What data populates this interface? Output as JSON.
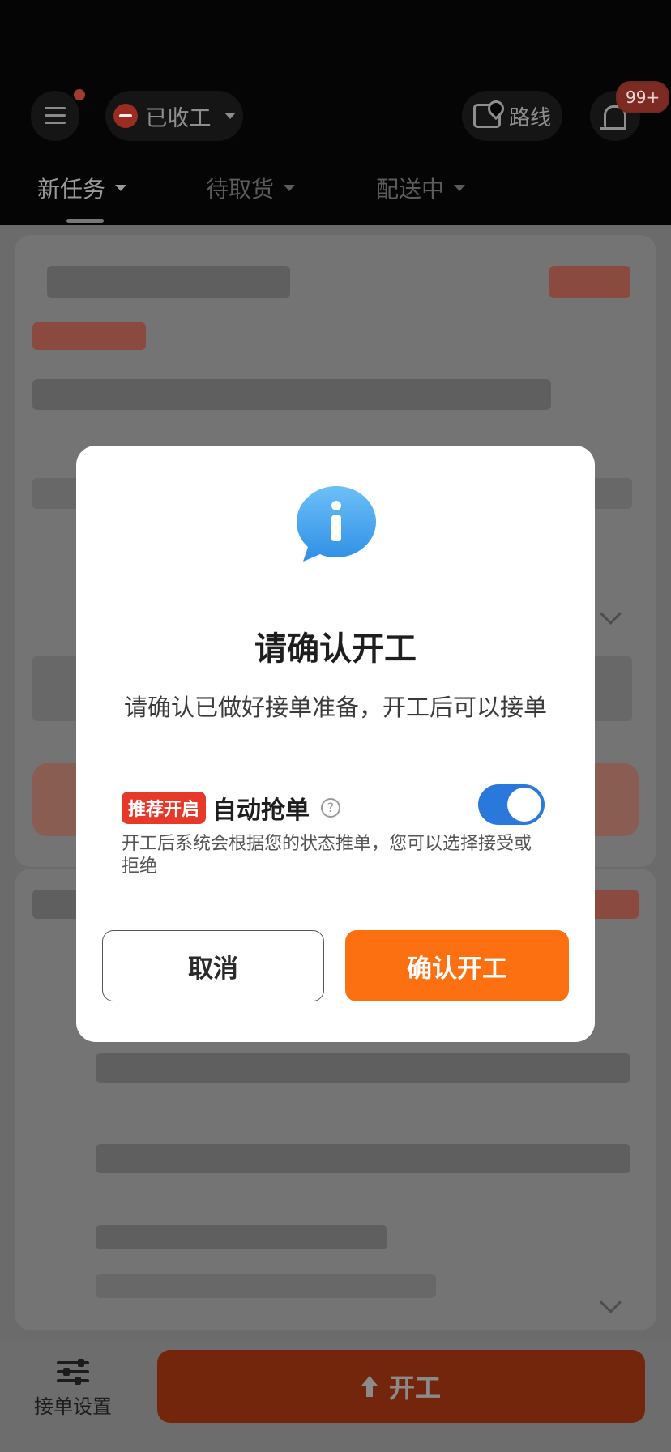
{
  "header": {
    "status_label": "已收工",
    "route_label": "路线",
    "notification_badge": "99+"
  },
  "tabs": [
    {
      "label": "新任务",
      "active": true
    },
    {
      "label": "待取货",
      "active": false
    },
    {
      "label": "配送中",
      "active": false
    }
  ],
  "bottom_bar": {
    "settings_label": "接单设置",
    "start_label": "开工"
  },
  "dialog": {
    "title": "请确认开工",
    "message": "请确认已做好接单准备，开工后可以接单",
    "recommend_tag": "推荐开启",
    "auto_grab_label": "自动抢单",
    "auto_grab_enabled": true,
    "auto_grab_description": "开工后系统会根据您的状态推单，您可以选择接受或拒绝",
    "cancel_label": "取消",
    "confirm_label": "确认开工"
  },
  "colors": {
    "primary_orange": "#fd7012",
    "toggle_blue": "#2a78dc",
    "tag_red": "#e8382a",
    "info_blue": "#4aa8f0"
  }
}
